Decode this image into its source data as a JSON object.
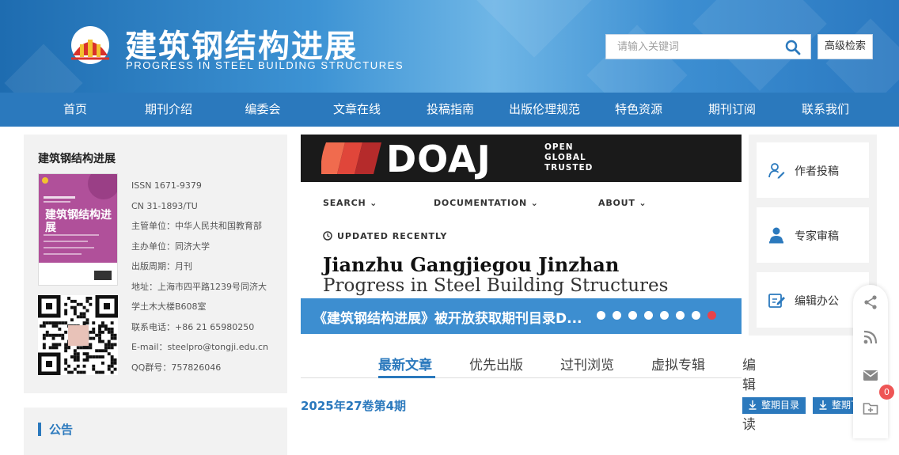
{
  "header": {
    "title_cn": "建筑钢结构进展",
    "title_en": "PROGRESS IN STEEL BUILDING STRUCTURES",
    "search_placeholder": "请输入关键词",
    "advanced_search": "高级检索"
  },
  "nav": {
    "items": [
      "首页",
      "期刊介绍",
      "编委会",
      "文章在线",
      "投稿指南",
      "出版伦理规范",
      "特色资源",
      "期刊订阅",
      "联系我们"
    ]
  },
  "journal": {
    "card_title": "建筑钢结构进展",
    "cover_title": "建筑钢结构进展",
    "info": [
      "ISSN 1671-9379",
      "CN 31-1893/TU",
      "主管单位：中华人民共和国教育部",
      "主办单位：同济大学",
      "出版周期：月刊",
      "地址：上海市四平路1239号同济大",
      "学土木大楼B608室",
      "联系电话：+86 21 65980250",
      "E-mail：steelpro@tongji.edu.cn",
      "QQ群号：757826046"
    ]
  },
  "notice": {
    "title": "公告"
  },
  "banner": {
    "doaj_word": "DOAJ",
    "doaj_tag1": "OPEN",
    "doaj_tag2": "GLOBAL",
    "doaj_tag3": "TRUSTED",
    "menu": [
      "SEARCH",
      "DOCUMENTATION",
      "ABOUT"
    ],
    "updated": "UPDATED RECENTLY",
    "title1": "Jianzhu Gangjiegou Jinzhan",
    "title2": "Progress in Steel Building Structures",
    "caption": "《建筑钢结构进展》被开放获取期刊目录D...",
    "slide_count": 8,
    "active_slide": 8
  },
  "tabs": {
    "items": [
      "最新文章",
      "优先出版",
      "过刊浏览",
      "虚拟专辑",
      "编辑荐读"
    ],
    "active": 0
  },
  "issue": {
    "title": "2025年27卷第4期",
    "btn_toc": "整期目录",
    "btn_full": "整期下载"
  },
  "side": {
    "items": [
      "作者投稿",
      "专家审稿",
      "编辑办公"
    ]
  },
  "float": {
    "badge": "0"
  },
  "colors": {
    "primary": "#2b79bd",
    "header_light": "#6fb6e6",
    "badge": "#ee5555"
  }
}
